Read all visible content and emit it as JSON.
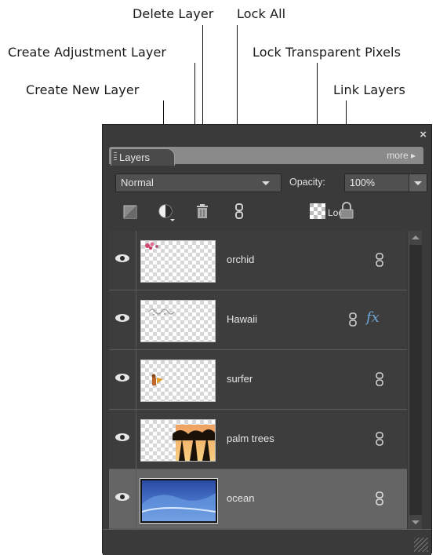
{
  "callouts": {
    "delete_layer": "Delete Layer",
    "lock_all": "Lock All",
    "create_adjustment_layer": "Create Adjustment Layer",
    "lock_transparent_pixels": "Lock Transparent Pixels",
    "create_new_layer": "Create New Layer",
    "link_layers": "Link Layers"
  },
  "panel": {
    "close_glyph": "×",
    "tab_label": "Layers",
    "more_label": "more ▸",
    "blend_mode": "Normal",
    "opacity_label": "Opacity:",
    "opacity_value": "100%",
    "lock_label": "Lock:"
  },
  "layers": [
    {
      "name": "orchid",
      "selected": false,
      "linked": true,
      "has_fx": false
    },
    {
      "name": "Hawaii",
      "selected": false,
      "linked": true,
      "has_fx": true,
      "fx_label": "fx"
    },
    {
      "name": "surfer",
      "selected": false,
      "linked": true,
      "has_fx": false
    },
    {
      "name": "palm trees",
      "selected": false,
      "linked": true,
      "has_fx": false
    },
    {
      "name": "ocean",
      "selected": true,
      "linked": true,
      "has_fx": false
    }
  ],
  "icons": [
    "new-layer-icon",
    "adjustment-layer-icon",
    "trash-icon",
    "link-chain-icon",
    "lock-transparent-icon",
    "lock-all-icon",
    "eye-icon",
    "close-icon"
  ],
  "colors": {
    "panel_bg": "#3a3a3a",
    "selected_row": "#656565",
    "fx_blue": "#6fa6d6"
  }
}
